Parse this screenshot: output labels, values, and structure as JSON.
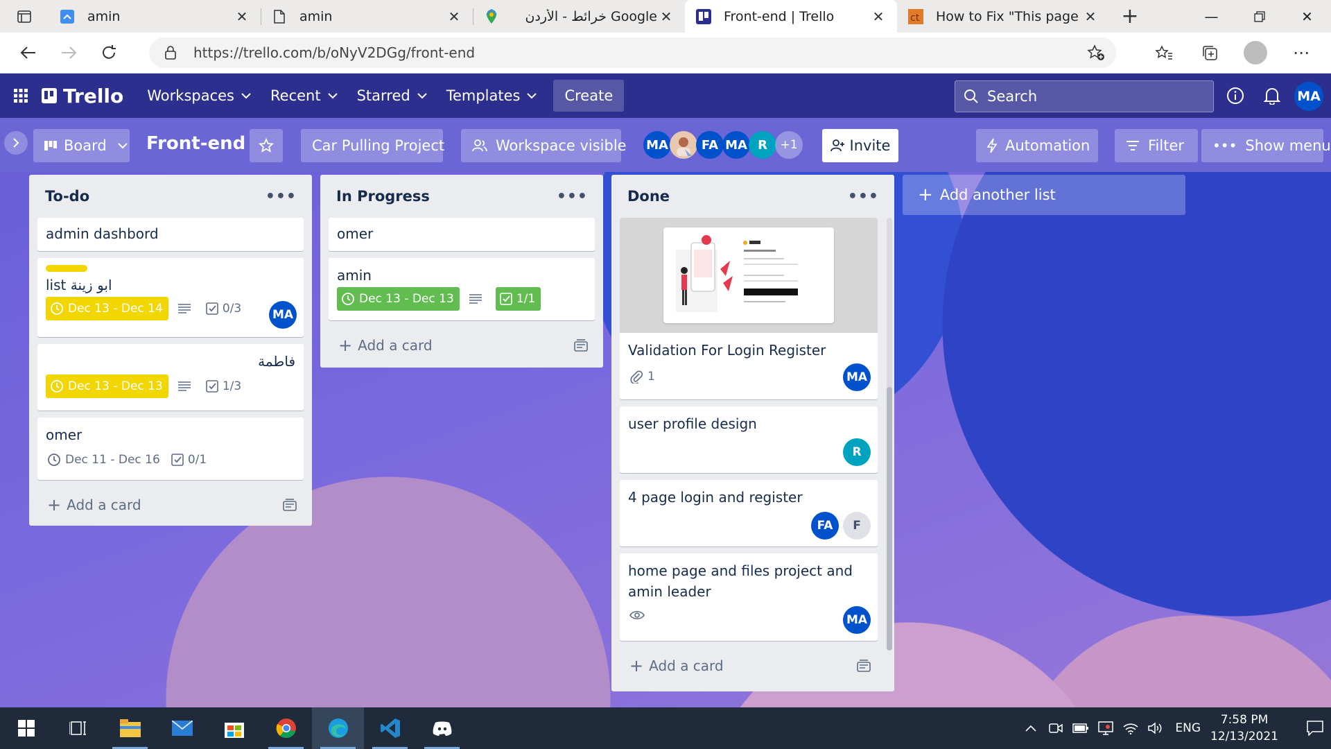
{
  "browser": {
    "tabs": [
      {
        "title": "amin",
        "icon": "trello-favicon"
      },
      {
        "title": "amin",
        "icon": "page-icon"
      },
      {
        "title": "Google خرائط - الأردن",
        "icon": "maps-icon"
      },
      {
        "title": "Front-end | Trello",
        "icon": "trello-favicon",
        "active": true
      },
      {
        "title": "How to Fix \"This page did",
        "icon": "ct-favicon"
      }
    ],
    "url": "https://trello.com/b/oNyV2DGg/front-end"
  },
  "trello_header": {
    "logo": "Trello",
    "nav": [
      "Workspaces",
      "Recent",
      "Starred",
      "Templates"
    ],
    "create": "Create",
    "search_placeholder": "Search",
    "user_initials": "MA"
  },
  "board_bar": {
    "view": "Board",
    "title": "Front-end",
    "workspace": "Car Pulling Project",
    "visibility": "Workspace visible",
    "members": [
      "MA",
      "",
      "FA",
      "MA",
      "R"
    ],
    "more_members": "+1",
    "invite": "Invite",
    "automation": "Automation",
    "filter": "Filter",
    "show_menu": "Show menu"
  },
  "lists": [
    {
      "name": "To-do",
      "cards": [
        {
          "title": "admin dashbord"
        },
        {
          "title": "list ابو زينة",
          "label_color": "#f2d600",
          "due": "Dec 13 - Dec 14",
          "checklist": "0/3",
          "member": "MA"
        },
        {
          "title": "فاطمة",
          "due": "Dec 13 - Dec 13",
          "checklist": "1/3"
        },
        {
          "title": "omer",
          "due": "Dec 11 - Dec 16",
          "checklist": "0/1"
        }
      ],
      "add_card": "Add a card"
    },
    {
      "name": "In Progress",
      "cards": [
        {
          "title": "omer"
        },
        {
          "title": "amin",
          "due": "Dec 13 - Dec 13",
          "checklist": "1/1"
        }
      ],
      "add_card": "Add a card"
    },
    {
      "name": "Done",
      "cards": [
        {
          "title": "Validation For Login Register",
          "attachments": "1",
          "member": "MA"
        },
        {
          "title": "user profile design",
          "member": "R"
        },
        {
          "title": "4 page login and register",
          "members": [
            "FA",
            "F"
          ]
        },
        {
          "title": "home page and files project and amin leader",
          "member": "MA"
        }
      ],
      "add_card": "Add a card"
    }
  ],
  "add_list": "Add another list",
  "taskbar": {
    "lang": "ENG",
    "time": "7:58 PM",
    "date": "12/13/2021"
  },
  "colors": {
    "header": "#2d2f8f",
    "list_bg": "#ebecf0",
    "due_yellow": "#f2d600",
    "due_green": "#61bd4f",
    "avatar_blue": "#0052cc",
    "avatar_teal": "#00a3bf"
  }
}
